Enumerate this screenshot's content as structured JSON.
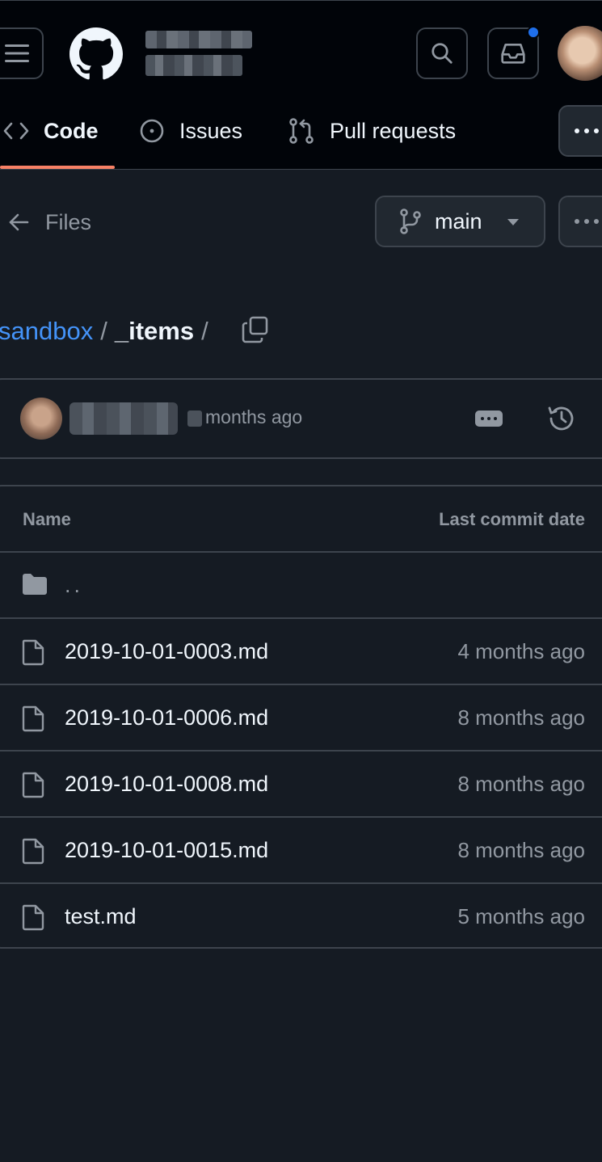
{
  "header": {
    "menu_icon": "hamburger-icon",
    "logo_icon": "github-mark-icon",
    "search_icon": "search-icon",
    "inbox_icon": "inbox-icon",
    "notification_color": "#1f6feb"
  },
  "tabs": [
    {
      "label": "Code",
      "icon": "code-icon",
      "selected": true
    },
    {
      "label": "Issues",
      "icon": "issue-opened-icon",
      "selected": false
    },
    {
      "label": "Pull requests",
      "icon": "git-pull-request-icon",
      "selected": false
    }
  ],
  "files_header": {
    "back_label": "Files",
    "branch": "main"
  },
  "breadcrumb": {
    "repo": "sandbox",
    "separator": "/",
    "current": "_items",
    "trailing_separator": "/"
  },
  "latest_commit": {
    "time": "months ago"
  },
  "table": {
    "headers": {
      "name": "Name",
      "date": "Last commit date"
    },
    "parent": "..",
    "rows": [
      {
        "name": "2019-10-01-0003.md",
        "date": "4 months ago"
      },
      {
        "name": "2019-10-01-0006.md",
        "date": "8 months ago"
      },
      {
        "name": "2019-10-01-0008.md",
        "date": "8 months ago"
      },
      {
        "name": "2019-10-01-0015.md",
        "date": "8 months ago"
      },
      {
        "name": "test.md",
        "date": "5 months ago"
      }
    ]
  },
  "colors": {
    "accent_underline": "#f78166",
    "link": "#4493f8",
    "background": "#151b23",
    "header_background": "#010409"
  }
}
